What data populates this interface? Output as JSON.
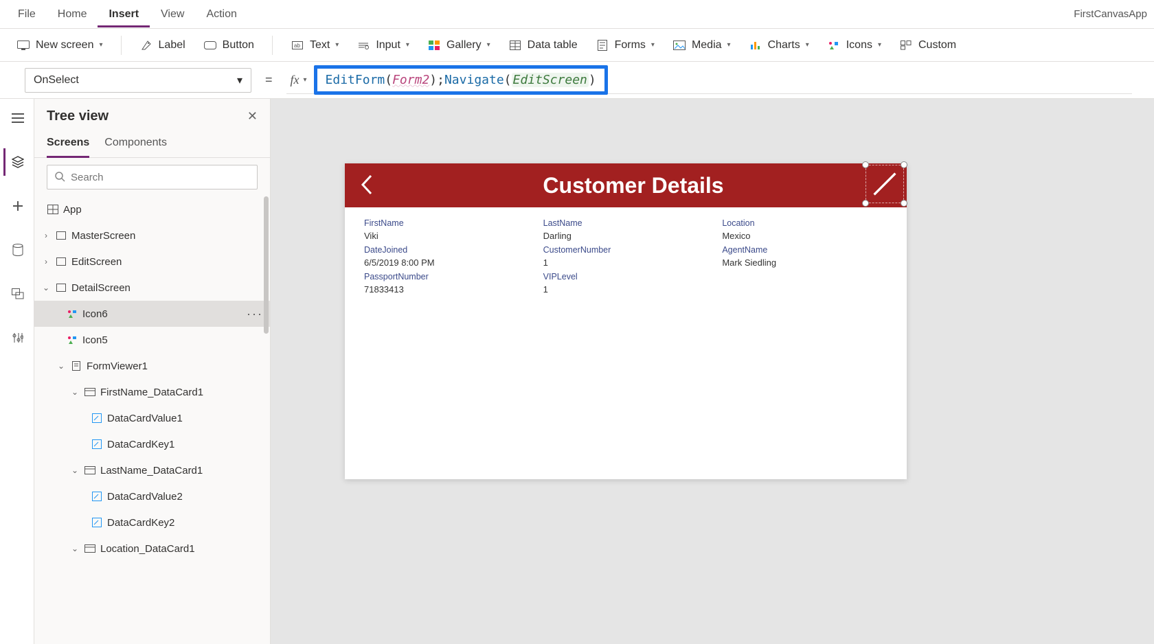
{
  "appName": "FirstCanvasApp",
  "menu": {
    "file": "File",
    "home": "Home",
    "insert": "Insert",
    "view": "View",
    "action": "Action"
  },
  "ribbon": {
    "newScreen": "New screen",
    "label": "Label",
    "button": "Button",
    "text": "Text",
    "input": "Input",
    "gallery": "Gallery",
    "dataTable": "Data table",
    "forms": "Forms",
    "media": "Media",
    "charts": "Charts",
    "icons": "Icons",
    "custom": "Custom"
  },
  "propertySelector": "OnSelect",
  "formula": {
    "fn1": "EditForm",
    "arg1": "Form2",
    "fn2": "Navigate",
    "arg2": "EditScreen"
  },
  "treePanel": {
    "title": "Tree view",
    "tabScreens": "Screens",
    "tabComponents": "Components",
    "searchPlaceholder": "Search",
    "items": {
      "app": "App",
      "master": "MasterScreen",
      "edit": "EditScreen",
      "detail": "DetailScreen",
      "icon6": "Icon6",
      "icon5": "Icon5",
      "formViewer": "FormViewer1",
      "fnCard": "FirstName_DataCard1",
      "dcv1": "DataCardValue1",
      "dck1": "DataCardKey1",
      "lnCard": "LastName_DataCard1",
      "dcv2": "DataCardValue2",
      "dck2": "DataCardKey2",
      "locCard": "Location_DataCard1"
    }
  },
  "canvas": {
    "headerTitle": "Customer Details",
    "fields": {
      "firstName": {
        "label": "FirstName",
        "value": "Viki"
      },
      "lastName": {
        "label": "LastName",
        "value": "Darling"
      },
      "location": {
        "label": "Location",
        "value": "Mexico"
      },
      "dateJoined": {
        "label": "DateJoined",
        "value": "6/5/2019 8:00 PM"
      },
      "customerNumber": {
        "label": "CustomerNumber",
        "value": "1"
      },
      "agentName": {
        "label": "AgentName",
        "value": "Mark Siedling"
      },
      "passportNumber": {
        "label": "PassportNumber",
        "value": "71833413"
      },
      "vipLevel": {
        "label": "VIPLevel",
        "value": "1"
      }
    }
  }
}
